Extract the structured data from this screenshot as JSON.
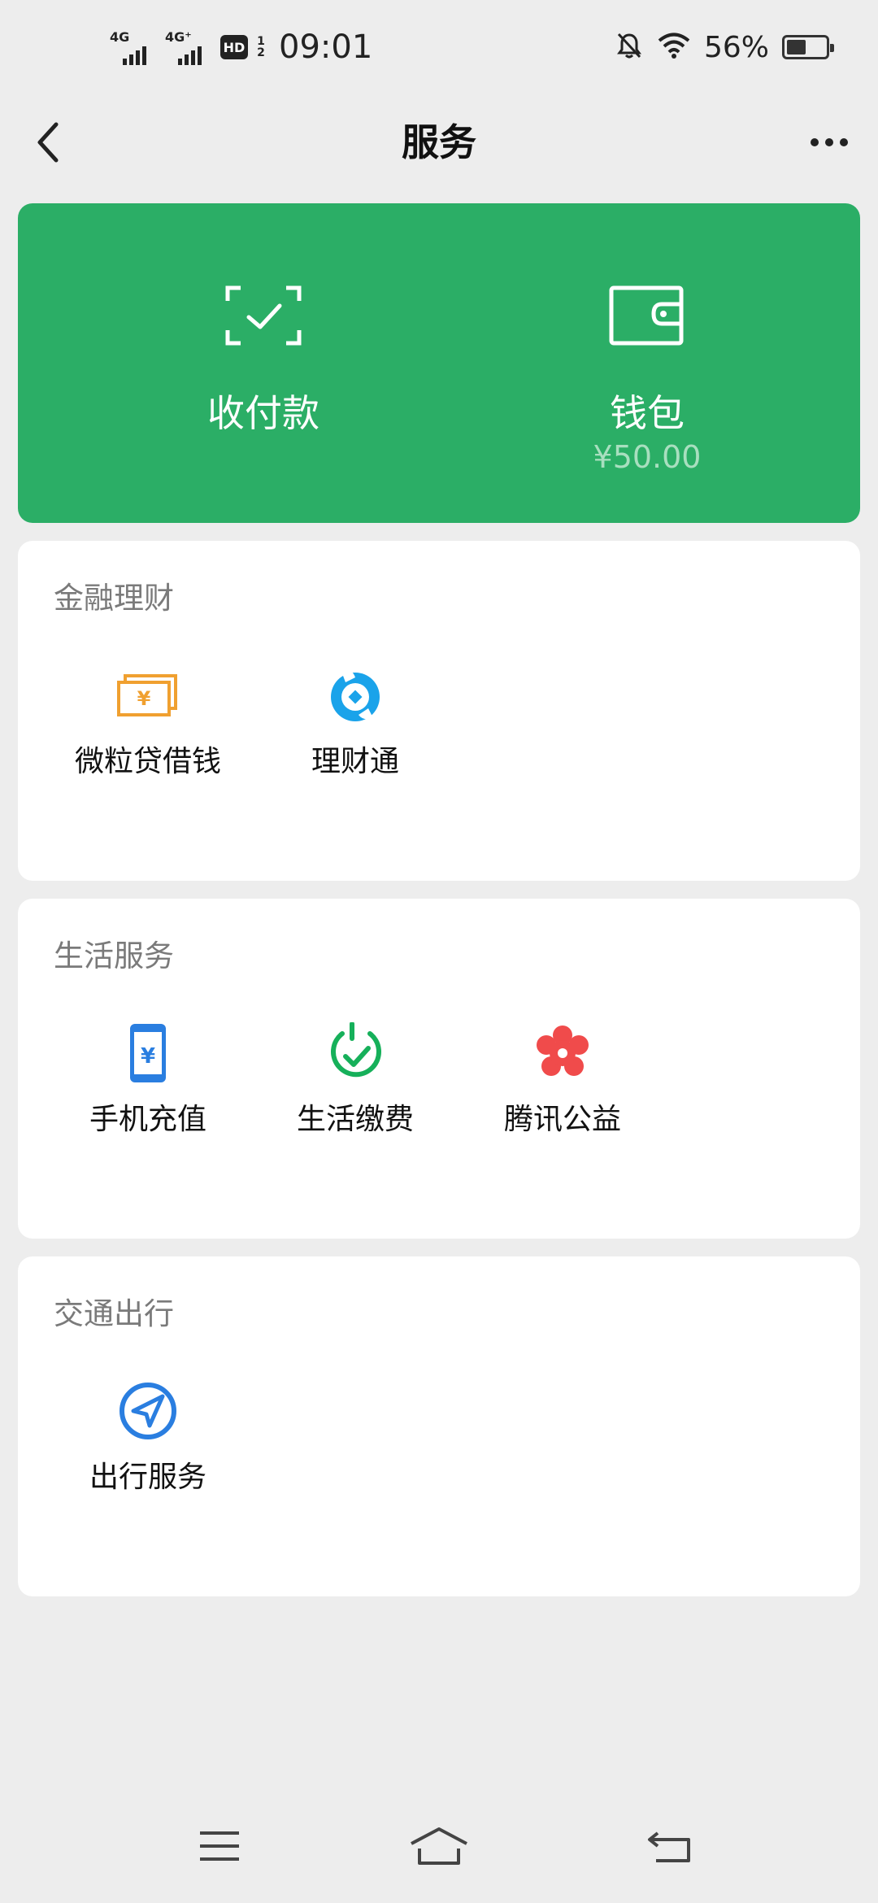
{
  "status_bar": {
    "network1": "4G",
    "network2": "4G⁺",
    "hd": "HD",
    "hd_num_top": "1",
    "hd_num_bottom": "2",
    "time": "09:01",
    "battery": "56%",
    "battery_level": 0.56
  },
  "nav": {
    "title": "服务"
  },
  "pay_card": {
    "color": "#2bae66",
    "pay_label": "收付款",
    "wallet_label": "钱包",
    "wallet_balance": "¥50.00"
  },
  "sections": {
    "finance": {
      "title": "金融理财",
      "items": [
        "微粒贷借钱",
        "理财通"
      ]
    },
    "life": {
      "title": "生活服务",
      "items": [
        "手机充值",
        "生活缴费",
        "腾讯公益"
      ]
    },
    "transport": {
      "title": "交通出行",
      "items": [
        "出行服务"
      ]
    }
  },
  "icons": {
    "pay": "scan-check-icon",
    "wallet": "wallet-icon",
    "loan": "money-bills-icon",
    "wealth": "wealth-coin-icon",
    "phone_topup": "phone-yuan-icon",
    "bills": "check-circle-icon",
    "charity": "flower-icon",
    "travel": "navigation-icon"
  }
}
